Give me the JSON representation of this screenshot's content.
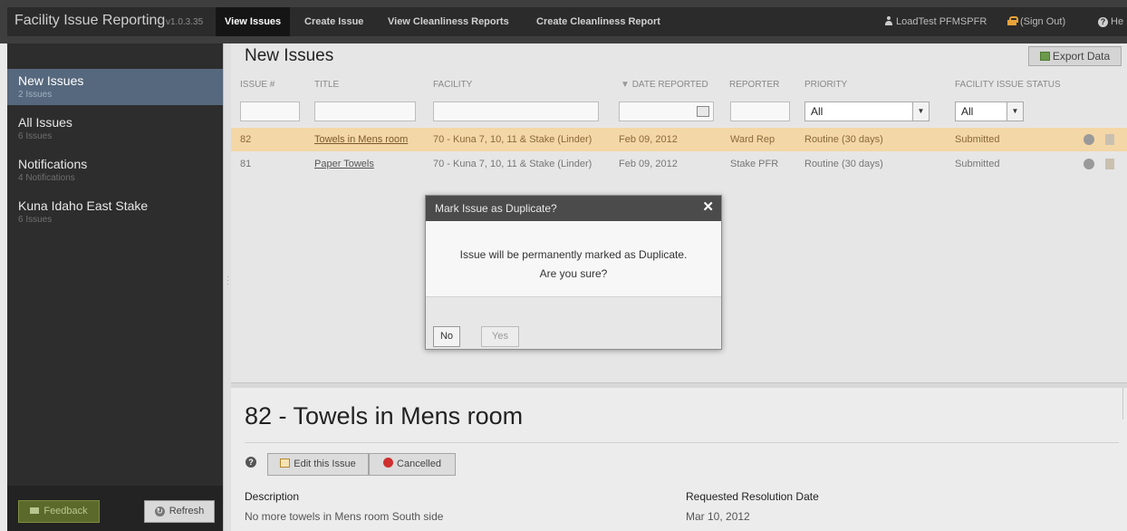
{
  "app": {
    "title": "Facility Issue Reporting",
    "version": "v1.0.3.35"
  },
  "nav": {
    "tabs": [
      {
        "label": "View Issues"
      },
      {
        "label": "Create Issue"
      },
      {
        "label": "View Cleanliness Reports"
      },
      {
        "label": "Create Cleanliness Report"
      }
    ],
    "user_name": "LoadTest PFMSPFR",
    "sign_out": "(Sign Out)",
    "help": "He"
  },
  "sidebar": {
    "items": [
      {
        "title": "New Issues",
        "sub": "2 Issues"
      },
      {
        "title": "All Issues",
        "sub": "6 Issues"
      },
      {
        "title": "Notifications",
        "sub": "4 Notifications"
      },
      {
        "title": "Kuna Idaho East Stake",
        "sub": "6 Issues"
      }
    ],
    "feedback_label": "Feedback",
    "refresh_label": "Refresh"
  },
  "list": {
    "title": "New Issues",
    "export_label": "Export Data",
    "columns": [
      "ISSUE #",
      "TITLE",
      "FACILITY",
      "DATE REPORTED",
      "REPORTER",
      "PRIORITY",
      "FACILITY ISSUE STATUS"
    ],
    "sort_indicator": "▼",
    "filters": {
      "priority": "All",
      "status": "All"
    },
    "rows": [
      {
        "id": "82",
        "title": "Towels in Mens room",
        "facility": "70 - Kuna 7, 10, 11 & Stake (Linder)",
        "date": "Feb 09, 2012",
        "reporter": "Ward Rep",
        "priority": "Routine (30 days)",
        "status": "Submitted"
      },
      {
        "id": "81",
        "title": "Paper Towels",
        "facility": "70 - Kuna 7, 10, 11 & Stake (Linder)",
        "date": "Feb 09, 2012",
        "reporter": "Stake PFR",
        "priority": "Routine (30 days)",
        "status": "Submitted"
      }
    ]
  },
  "detail": {
    "title": "82 - Towels in Mens room",
    "edit_label": "Edit this Issue",
    "cancelled_label": "Cancelled",
    "description_label": "Description",
    "description_value": "No more towels in Mens room South side",
    "resolution_label": "Requested Resolution Date",
    "resolution_value": "Mar 10, 2012"
  },
  "modal": {
    "title": "Mark Issue as Duplicate?",
    "line1": "Issue will be permanently marked as Duplicate.",
    "line2": "Are you sure?",
    "no_label": "No",
    "yes_label": "Yes"
  },
  "colors": {
    "selected_row": "#f4d7a6",
    "active_sidebar": "#56687d",
    "topbar": "#2b2b2b",
    "modal_header": "#4b4b4b"
  }
}
